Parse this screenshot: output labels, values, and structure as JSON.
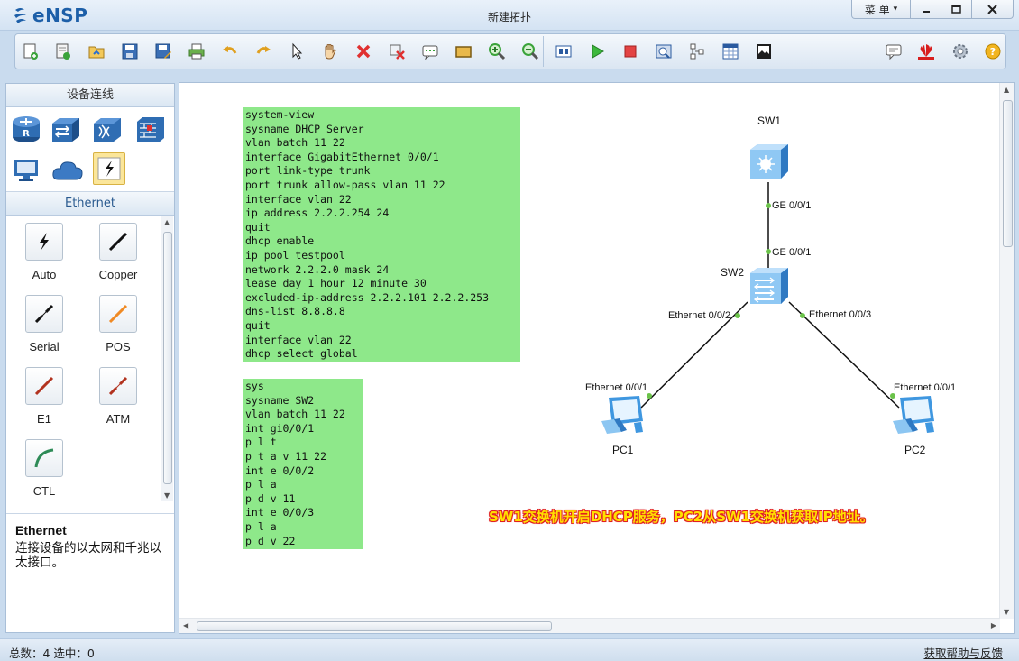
{
  "app": {
    "name": "eNSP",
    "window_title": "新建拓扑",
    "menu_label": "菜 单",
    "menu_arrow": "▾"
  },
  "toolbar": {
    "icons": [
      "new-topology-icon",
      "new-lab-icon",
      "open-icon",
      "save-icon",
      "save-as-icon",
      "print-icon",
      "undo-icon",
      "redo-icon",
      "select-pointer-icon",
      "pan-hand-icon",
      "delete-icon",
      "delete-link-icon",
      "text-note-icon",
      "rectangle-icon",
      "zoom-in-icon",
      "zoom-out-icon",
      "fit-window-icon",
      "start-device-icon",
      "stop-device-icon",
      "capture-icon",
      "topology-icon",
      "grid-icon",
      "screenshot-icon",
      "chat-icon",
      "huawei-logo-icon",
      "settings-icon",
      "help-icon"
    ]
  },
  "left_panel": {
    "title": "设备连线",
    "devices": [
      "router-icon",
      "switch-icon",
      "wireless-icon",
      "firewall-icon",
      "pc-terminal-icon",
      "cloud-icon",
      "connection-icon"
    ],
    "category": "Ethernet",
    "cables": [
      {
        "label": "Auto",
        "color": "#222222"
      },
      {
        "label": "Copper",
        "color": "#111111"
      },
      {
        "label": "Serial",
        "color": "#111111"
      },
      {
        "label": "POS",
        "color": "#f08a24"
      },
      {
        "label": "E1",
        "color": "#b2331f"
      },
      {
        "label": "ATM",
        "color": "#b2331f"
      },
      {
        "label": "CTL",
        "color": "#2e8b57"
      }
    ],
    "description_title": "Ethernet",
    "description_text": "连接设备的以太网和千兆以太接口。"
  },
  "canvas": {
    "config_box_1": "system-view\nsysname DHCP Server\nvlan batch 11 22\ninterface GigabitEthernet 0/0/1\nport link-type trunk\nport trunk allow-pass vlan 11 22\ninterface vlan 22\nip address 2.2.2.254 24\nquit\ndhcp enable\nip pool testpool\nnetwork 2.2.2.0 mask 24\nlease day 1 hour 12 minute 30\nexcluded-ip-address 2.2.2.101 2.2.2.253\ndns-list 8.8.8.8\nquit\ninterface vlan 22\ndhcp select global",
    "config_box_2": "sys\nsysname SW2\nvlan batch 11 22\nint gi0/0/1\np l t\np t a v 11 22\nint e 0/0/2\np l a\np d v 11\nint e 0/0/3\np l a\np d v 22",
    "devices": {
      "sw1": "SW1",
      "sw2": "SW2",
      "pc1": "PC1",
      "pc2": "PC2"
    },
    "ports": {
      "sw1_down": "GE 0/0/1",
      "sw2_up": "GE 0/0/1",
      "sw2_left": "Ethernet 0/0/2",
      "sw2_right": "Ethernet 0/0/3",
      "pc1_port": "Ethernet 0/0/1",
      "pc2_port": "Ethernet 0/0/1"
    },
    "note": "SW1交换机开启DHCP服务，PC2从SW1交换机获取IP地址。"
  },
  "statusbar": {
    "left": "总数：4  选中：0",
    "right": "获取帮助与反馈"
  }
}
